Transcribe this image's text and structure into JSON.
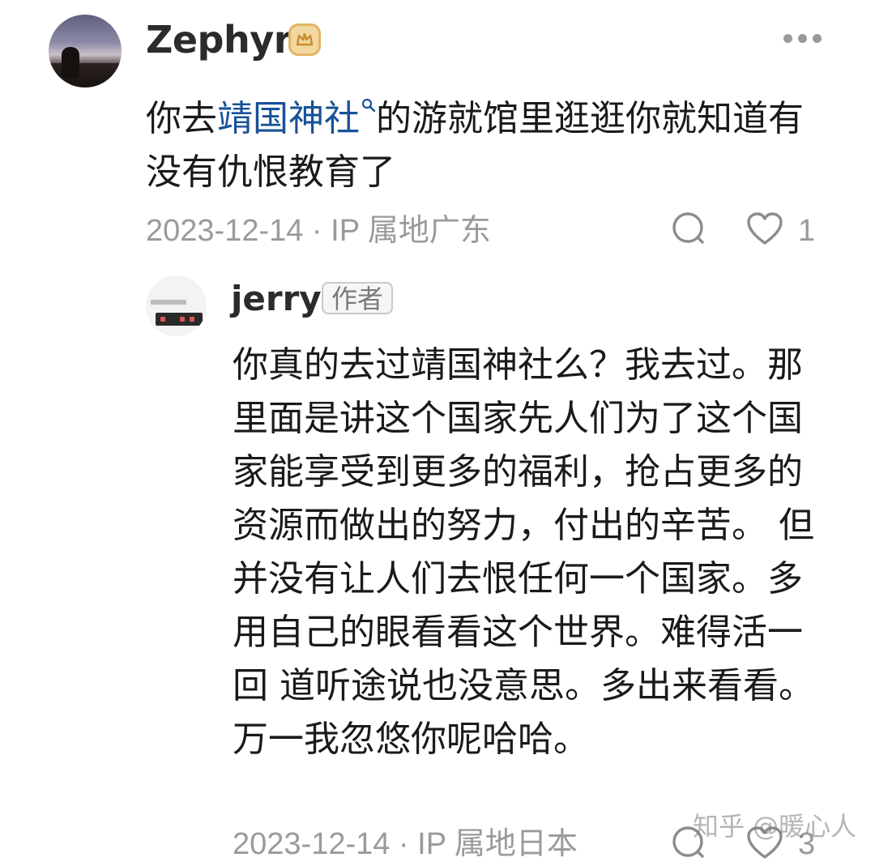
{
  "comment": {
    "author": "Zephyr",
    "text_before": "你去",
    "link_text": "靖国神社",
    "text_after": "的游就馆里逛逛你就知道有没有仇恨教育了",
    "date_location": "2023-12-14 · IP 属地广东",
    "like_count": "1"
  },
  "reply": {
    "author": "jerry",
    "author_tag": "作者",
    "text": "你真的去过靖国神社么？我去过。那里面是讲这个国家先人们为了这个国家能享受到更多的福利，抢占更多的资源而做出的努力，付出的辛苦。 但并没有让人们去恨任何一个国家。多用自己的眼看看这个世界。难得活一回 道听途说也没意思。多出来看看。万一我忽悠你呢哈哈。",
    "date_location": "2023-12-14 · IP 属地日本",
    "like_count": "3"
  },
  "watermark": "知乎 @暖心人",
  "colors": {
    "link": "#175199",
    "meta": "#9a9a9a",
    "badge": "#e2b463"
  },
  "icons": [
    "crown-badge-icon",
    "more-icon",
    "comment-icon",
    "heart-icon",
    "search-icon"
  ]
}
